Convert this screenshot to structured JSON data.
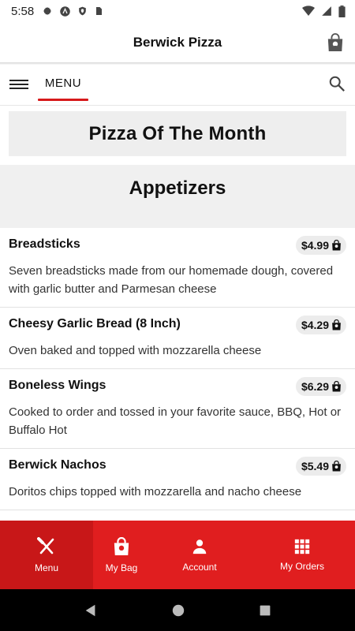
{
  "status_bar": {
    "time": "5:58"
  },
  "header": {
    "title": "Berwick Pizza"
  },
  "nav": {
    "active_tab": "MENU"
  },
  "featured": {
    "label": "Pizza Of The Month"
  },
  "category": {
    "title": "Appetizers"
  },
  "items": [
    {
      "name": "Breadsticks",
      "price": "$4.99",
      "description": "Seven breadsticks made from our homemade dough, covered with garlic butter and Parmesan cheese"
    },
    {
      "name": "Cheesy Garlic Bread (8 Inch)",
      "price": "$4.29",
      "description": "Oven baked and topped with mozzarella cheese"
    },
    {
      "name": "Boneless Wings",
      "price": "$6.29",
      "description": "Cooked to order and tossed in your favorite sauce, BBQ, Hot or Buffalo Hot"
    },
    {
      "name": "Berwick Nachos",
      "price": "$5.49",
      "description": "Doritos chips topped with mozzarella and nacho cheese"
    }
  ],
  "bottom_nav": {
    "menu": "Menu",
    "bag": "My Bag",
    "account": "Account",
    "orders": "My Orders"
  },
  "colors": {
    "accent": "#e01e1f",
    "accent_active": "#c81718",
    "panel": "#eeeeee"
  }
}
